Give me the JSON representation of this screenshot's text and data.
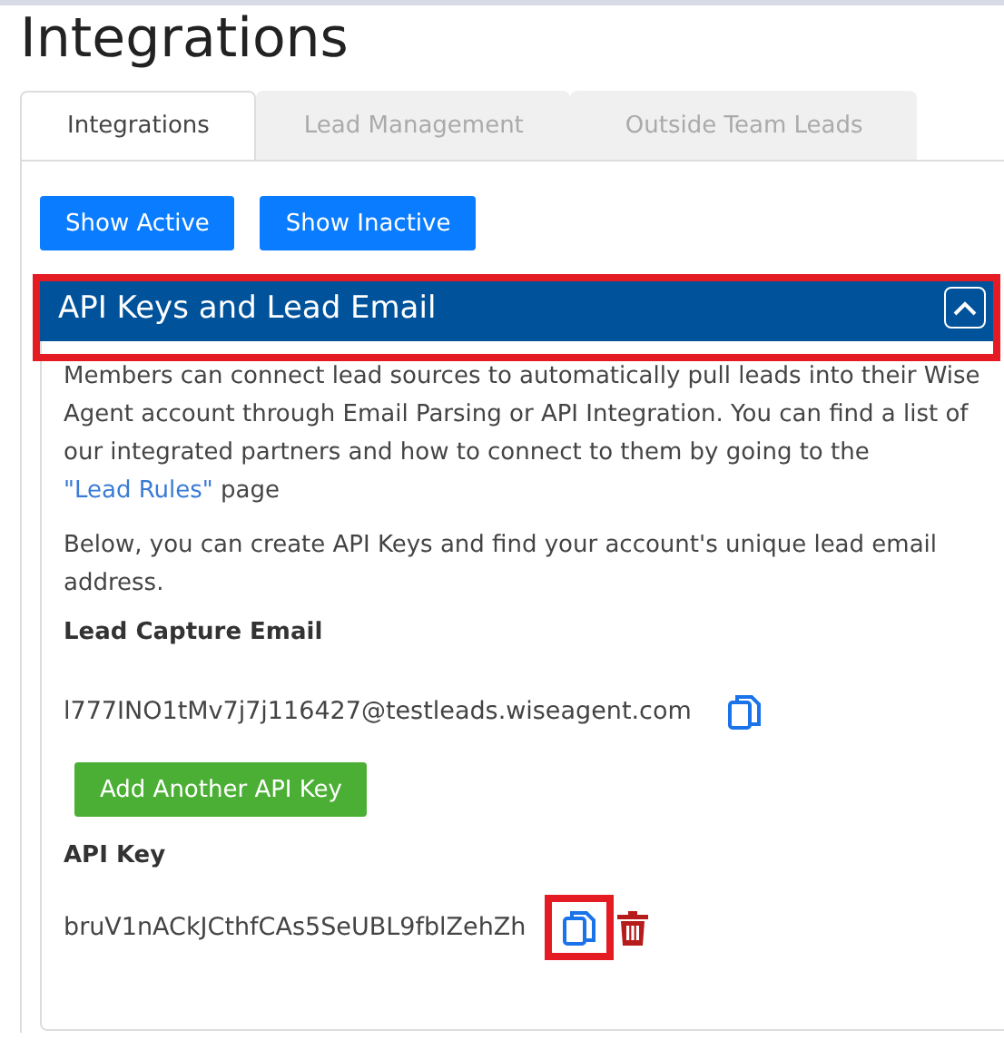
{
  "page_title": "Integrations",
  "tabs": [
    {
      "label": "Integrations",
      "selected": true
    },
    {
      "label": "Lead Management",
      "selected": false
    },
    {
      "label": "Outside Team Leads",
      "selected": false
    }
  ],
  "filter_buttons": [
    "Show Active",
    "Show Inactive"
  ],
  "panel": {
    "title": "API Keys and Lead Email",
    "expanded": true,
    "highlighted": true,
    "intro": {
      "before": "Members can connect lead sources to automatically pull leads into their Wise Agent account through Email Parsing or API Integration. You can find a list of our integrated partners and how to connect to them by going to the ",
      "link": "\"Lead Rules\"",
      "after": " page"
    },
    "note": "Below, you can create API Keys and find your account's unique lead email address.",
    "email_label": "Lead Capture Email",
    "email": {
      "value": "l777INO1tMv7j7j116427@testleads.wiseagent.com",
      "copy_highlighted": false
    },
    "add_button": "Add Another API Key",
    "key_label": "API Key",
    "keys": [
      {
        "value": "bruV1nACkJCthfCAs5SeUBL9fblZehZh",
        "copy_highlighted": true
      }
    ]
  }
}
